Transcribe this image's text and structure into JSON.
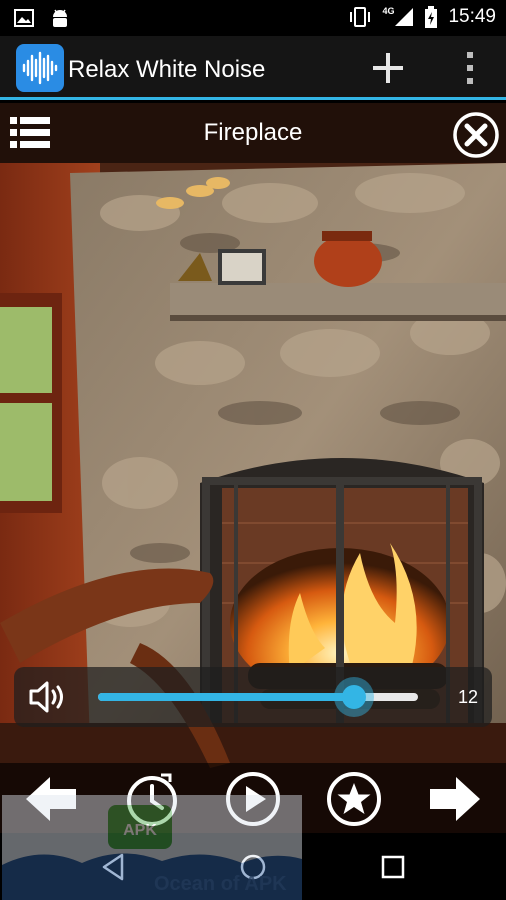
{
  "status_bar": {
    "time": "15:49",
    "network": "4G",
    "icons": [
      "image-icon",
      "android-icon",
      "vibrate-icon",
      "signal-icon",
      "battery-charging-icon"
    ]
  },
  "app_bar": {
    "title": "Relax White Noise",
    "logo_icon": "sound-wave-icon",
    "add_icon": "plus-icon",
    "menu_icon": "overflow-menu-icon"
  },
  "sound": {
    "title": "Fireplace",
    "list_icon": "list-icon",
    "close_icon": "close-circle-icon",
    "scene_image": "fireplace-room-photo"
  },
  "volume": {
    "value": "12",
    "level_fraction": 0.8,
    "icon": "speaker-icon"
  },
  "controls": [
    {
      "name": "previous-button",
      "icon": "arrow-left-icon"
    },
    {
      "name": "timer-button",
      "icon": "clock-icon"
    },
    {
      "name": "play-button",
      "icon": "play-icon"
    },
    {
      "name": "favorite-button",
      "icon": "star-icon"
    },
    {
      "name": "next-button",
      "icon": "arrow-right-icon"
    }
  ],
  "nav_bar": {
    "back_icon": "back-triangle-icon",
    "home_icon": "home-circle-icon",
    "recents_icon": "recents-square-icon"
  },
  "watermark": {
    "badge": "APK",
    "text": "Ocean of APK"
  },
  "colors": {
    "accent": "#33b5e5",
    "app_bar": "#151515",
    "logo": "#2a8ce4"
  }
}
